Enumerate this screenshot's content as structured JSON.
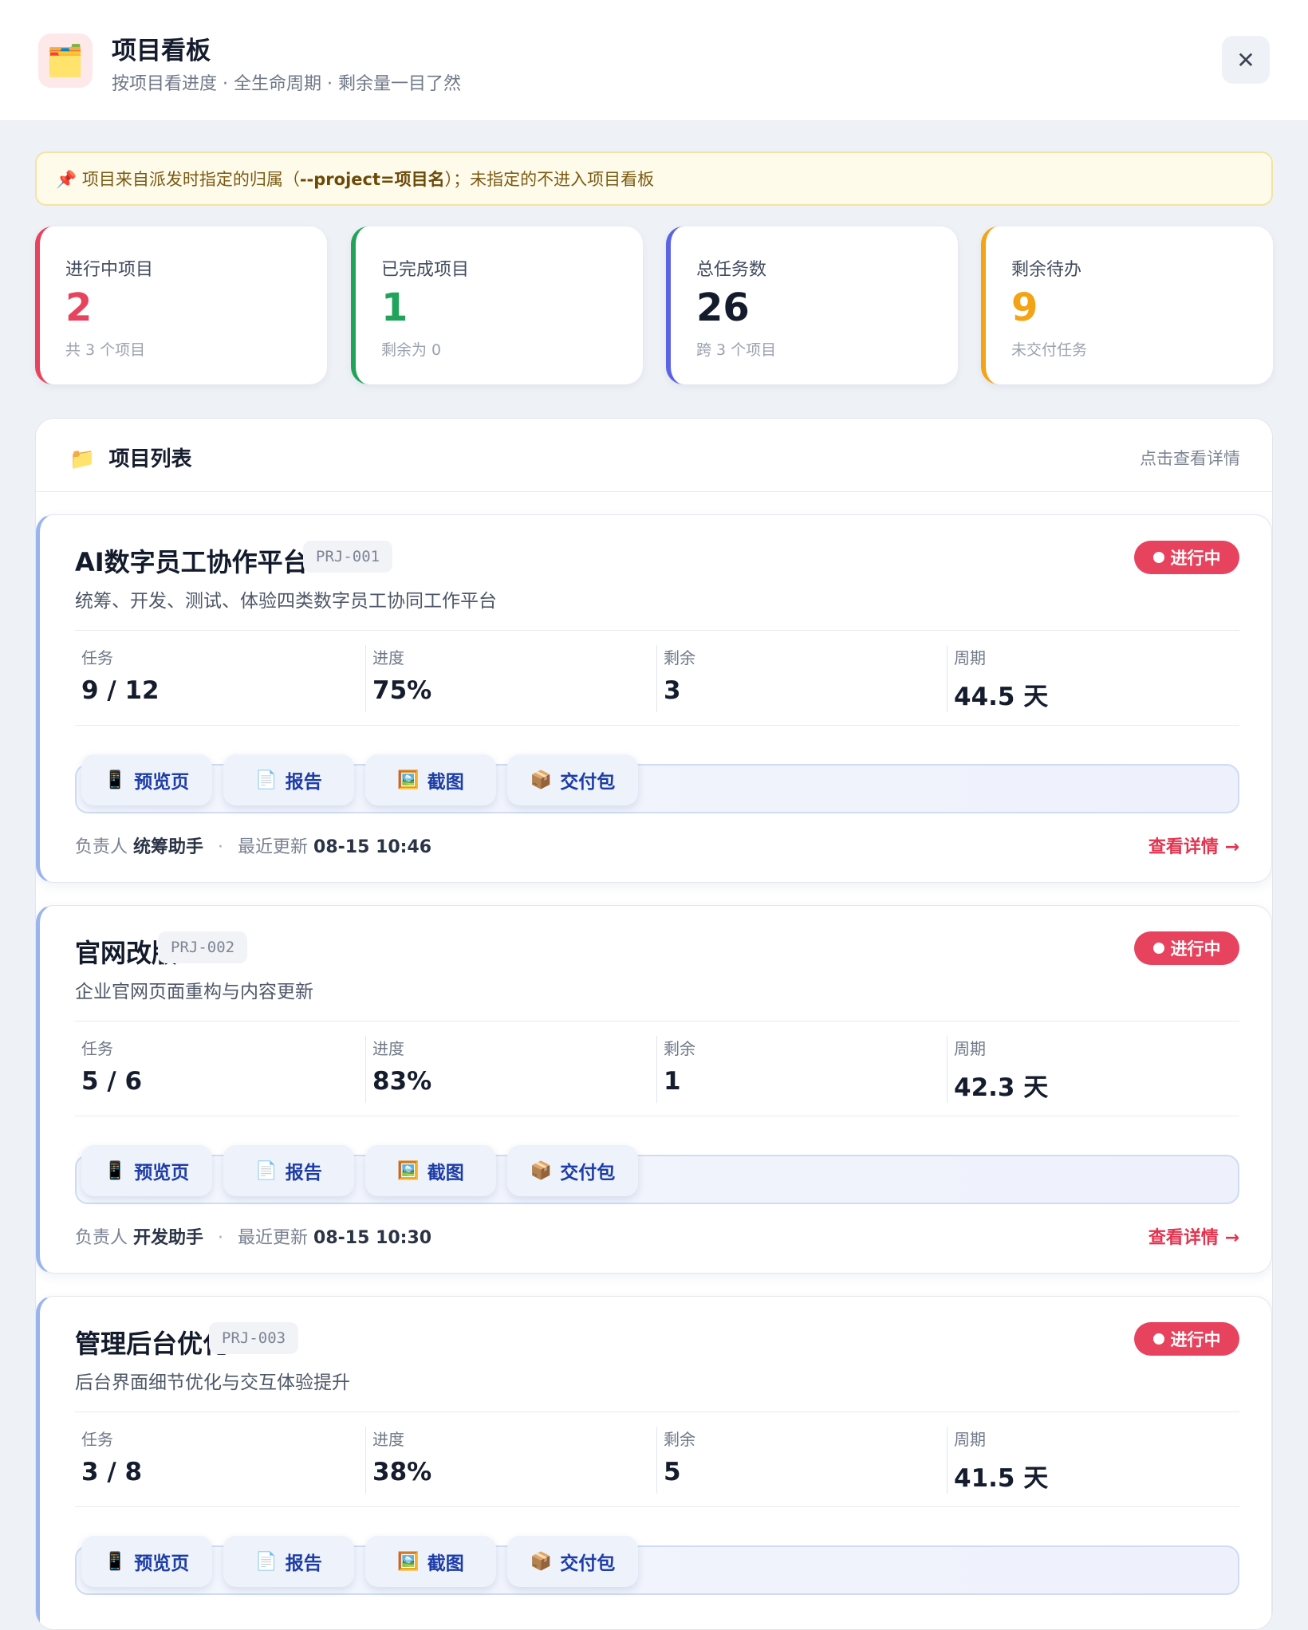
{
  "header": {
    "icon": "folder-card-icon",
    "title": "项目看板",
    "subtitle": "按项目看进度 · 全生命周期 · 剩余量一目了然",
    "close_label": "✕"
  },
  "notice": {
    "prefix": "📌 项目来自派发时指定的归属（",
    "code": "--project=项目名",
    "suffix": "）；未指定的不进入项目看板"
  },
  "stats": [
    {
      "label": "进行中项目",
      "value": "2",
      "sub": "共 3 个项目",
      "color": "#e8435e"
    },
    {
      "label": "已完成项目",
      "value": "1",
      "sub": "剩余为 0",
      "color": "#22a35a"
    },
    {
      "label": "总任务数",
      "value": "26",
      "sub": "跨 3 个项目",
      "color": "#5b62e6"
    },
    {
      "label": "剩余待办",
      "value": "9",
      "sub": "未交付任务",
      "color": "#f5a316"
    }
  ],
  "list": {
    "icon": "📁",
    "title": "项目列表",
    "hint": "点击查看详情"
  },
  "metric_labels": {
    "tasks": "任务",
    "progress": "进度",
    "remaining": "剩余",
    "cycle": "周期"
  },
  "actions": [
    {
      "icon": "📱",
      "label": "预览页"
    },
    {
      "icon": "📄",
      "label": "报告"
    },
    {
      "icon": "🖼️",
      "label": "截图"
    },
    {
      "icon": "📦",
      "label": "交付包"
    }
  ],
  "foot_labels": {
    "owner": "负责人",
    "updated": "最近更新",
    "detail": "查看详情 →"
  },
  "projects": [
    {
      "name": "AI数字员工协作平台",
      "code": "PRJ-001",
      "status": "进行中",
      "desc": "统筹、开发、测试、体验四类数字员工协同工作平台",
      "tasks": "9 / 12",
      "progress": "75%",
      "remaining": "3",
      "cycle": "44.5 天",
      "owner": "统筹助手",
      "updated": "08-15 10:46"
    },
    {
      "name": "官网改版",
      "code": "PRJ-002",
      "status": "进行中",
      "desc": "企业官网页面重构与内容更新",
      "tasks": "5 / 6",
      "progress": "83%",
      "remaining": "1",
      "cycle": "42.3 天",
      "owner": "开发助手",
      "updated": "08-15 10:30"
    },
    {
      "name": "管理后台优化",
      "code": "PRJ-003",
      "status": "进行中",
      "desc": "后台界面细节优化与交互体验提升",
      "tasks": "3 / 8",
      "progress": "38%",
      "remaining": "5",
      "cycle": "41.5 天"
    }
  ]
}
